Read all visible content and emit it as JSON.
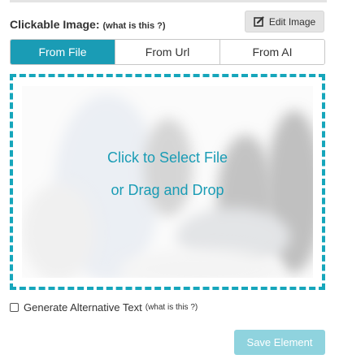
{
  "field": {
    "label": "Clickable Image:",
    "help_link": "(what is this ?)"
  },
  "edit_button": {
    "label": "Edit Image",
    "icon": "edit-icon"
  },
  "source_tabs": [
    {
      "label": "From File",
      "active": true
    },
    {
      "label": "From Url",
      "active": false
    },
    {
      "label": "From AI",
      "active": false
    }
  ],
  "dropzone": {
    "line1": "Click to Select File",
    "line2": "or Drag and Drop",
    "border_color": "#16a6bb",
    "text_color": "#1a9cb5"
  },
  "alt_text": {
    "label": "Generate Alternative Text",
    "help_link": "(what is this ?)",
    "checked": false
  },
  "save_button": {
    "label": "Save Element",
    "state": "disabled"
  },
  "colors": {
    "accent": "#1a9cb5",
    "accent_disabled": "#8fd3de",
    "button_gray": "#e4e4e4"
  }
}
